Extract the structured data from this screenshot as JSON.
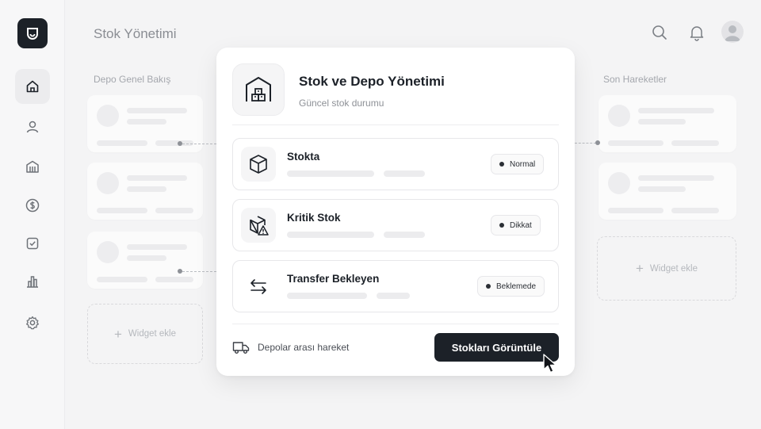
{
  "app": {
    "page_title": "Stok Yönetimi"
  },
  "header": {
    "search_icon": "search-icon",
    "notification_icon": "bell-icon",
    "avatar_icon": "user-avatar"
  },
  "sidebar": {
    "items": [
      {
        "name": "home",
        "icon": "home-icon",
        "active": true
      },
      {
        "name": "users",
        "icon": "user-icon",
        "active": false
      },
      {
        "name": "warehouse",
        "icon": "building-icon",
        "active": false
      },
      {
        "name": "finance",
        "icon": "dollar-icon",
        "active": false
      },
      {
        "name": "tasks",
        "icon": "checkbox-icon",
        "active": false
      },
      {
        "name": "reports",
        "icon": "bar-chart-icon",
        "active": false
      },
      {
        "name": "settings",
        "icon": "gear-icon",
        "active": false
      }
    ]
  },
  "left_panel": {
    "label": "Depo Genel Bakış",
    "widget_add": "Widget ekle"
  },
  "right_panel": {
    "label": "Son Hareketler",
    "widget_add": "Widget ekle"
  },
  "modal": {
    "title": "Stok ve Depo Yönetimi",
    "subtitle": "Güncel stok durumu",
    "rows": [
      {
        "title": "Stokta",
        "badge": "Normal",
        "icon": "box-icon"
      },
      {
        "title": "Kritik Stok",
        "badge": "Dikkat",
        "icon": "box-warning-icon"
      },
      {
        "title": "Transfer Bekleyen",
        "badge": "Beklemede",
        "icon": "transfer-arrows-icon"
      }
    ],
    "footer_link": "Depolar arası hareket",
    "footer_icon": "truck-icon",
    "cta": "Stokları Görüntüle"
  },
  "colors": {
    "accent_dark": "#1c2128",
    "background": "#f4f4f5",
    "card": "#ffffff"
  }
}
